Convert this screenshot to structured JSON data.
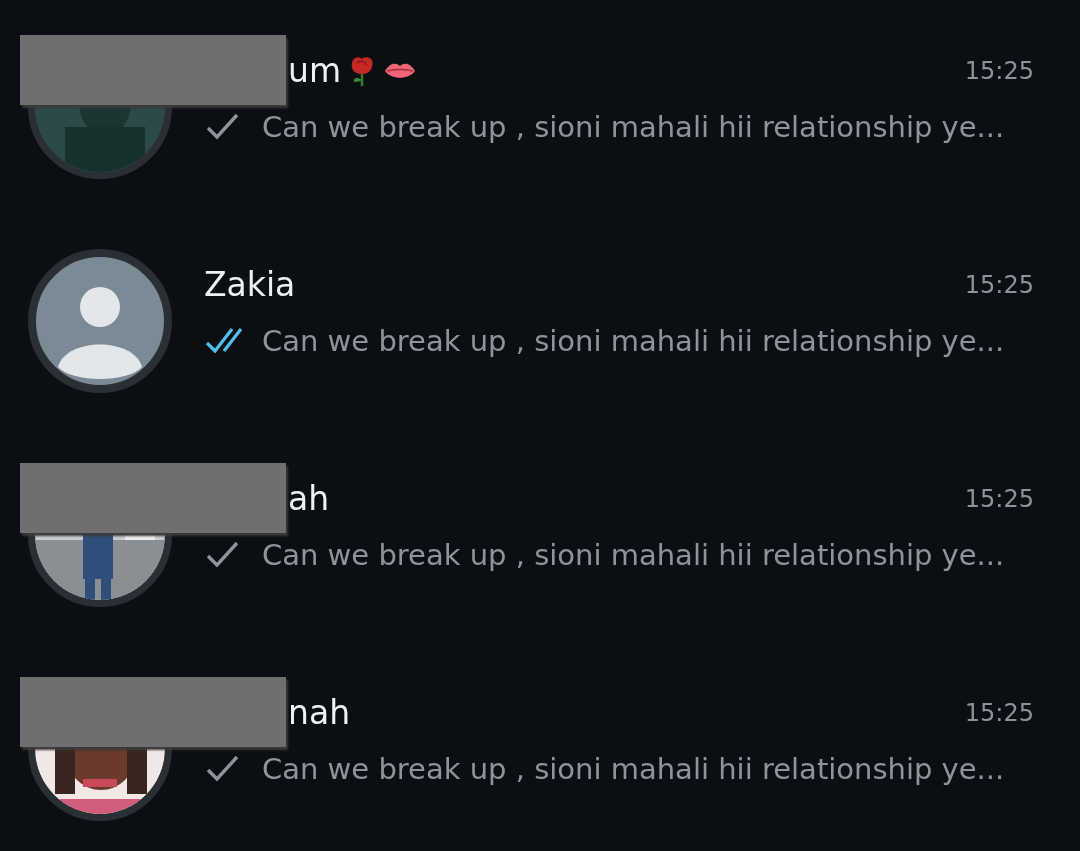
{
  "chats": [
    {
      "name": "um",
      "name_icons": [
        {
          "kind": "rose"
        },
        {
          "kind": "lips"
        }
      ],
      "time": "15:25",
      "read": false,
      "message": "Can we break up , sioni mahali hii relationship ye...",
      "redacted": true
    },
    {
      "name": "Zakia",
      "time": "15:25",
      "read": true,
      "message": "Can we break up , sioni mahali hii relationship ye...",
      "kind": "default",
      "redacted": false
    },
    {
      "name": "ah",
      "time": "15:25",
      "read": false,
      "message": "Can we break up , sioni mahali hii relationship ye...",
      "redacted": true
    },
    {
      "name": "nah",
      "time": "15:25",
      "read": false,
      "message": "Can we break up , sioni mahali hii relationship ye...",
      "redacted": true
    }
  ]
}
